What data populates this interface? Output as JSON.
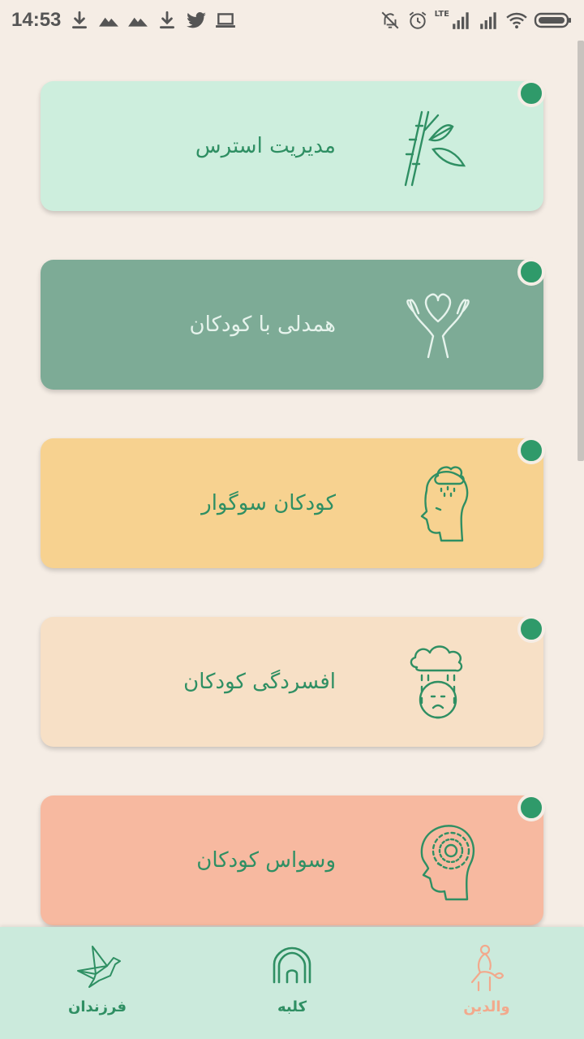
{
  "status_bar": {
    "time": "14:53",
    "network_label": "LTE",
    "left_icons": [
      "download-icon",
      "mountain-icon",
      "mountain-icon",
      "download-icon",
      "twitter-icon",
      "laptop-icon"
    ],
    "right_icons": [
      "bell-off-icon",
      "alarm-icon",
      "signal-icon",
      "signal-icon",
      "wifi-icon",
      "battery-icon"
    ]
  },
  "cards": [
    {
      "title": "مدیریت استرس",
      "icon": "bamboo-icon",
      "background": "#cdeedd",
      "text_color": "#2f8f63",
      "new_indicator": true
    },
    {
      "title": "همدلی با کودکان",
      "icon": "hands-heart-icon",
      "background": "#7dab96",
      "text_color": "#e6f3ec",
      "new_indicator": true
    },
    {
      "title": "کودکان سوگوار",
      "icon": "grieving-head-icon",
      "background": "#f7d290",
      "text_color": "#2f8f63",
      "new_indicator": true
    },
    {
      "title": "افسردگی کودکان",
      "icon": "rain-cloud-face-icon",
      "background": "#f7e0c6",
      "text_color": "#2f8f63",
      "new_indicator": true
    },
    {
      "title": "وسواس کودکان",
      "icon": "spiral-head-icon",
      "background": "#f7b9a0",
      "text_color": "#2f8f63",
      "new_indicator": true
    }
  ],
  "bottom_nav": {
    "items": [
      {
        "label": "فرزندان",
        "icon": "origami-bird-icon",
        "color": "#2f8f63",
        "active": false
      },
      {
        "label": "کلبه",
        "icon": "hut-icon",
        "color": "#2f8f63",
        "active": false
      },
      {
        "label": "والدین",
        "icon": "parent-figure-icon",
        "color": "#f2a98c",
        "active": true
      }
    ]
  },
  "colors": {
    "page_background": "#f5ede5",
    "accent_green": "#2f9a6a",
    "nav_background": "#cbeadc"
  }
}
